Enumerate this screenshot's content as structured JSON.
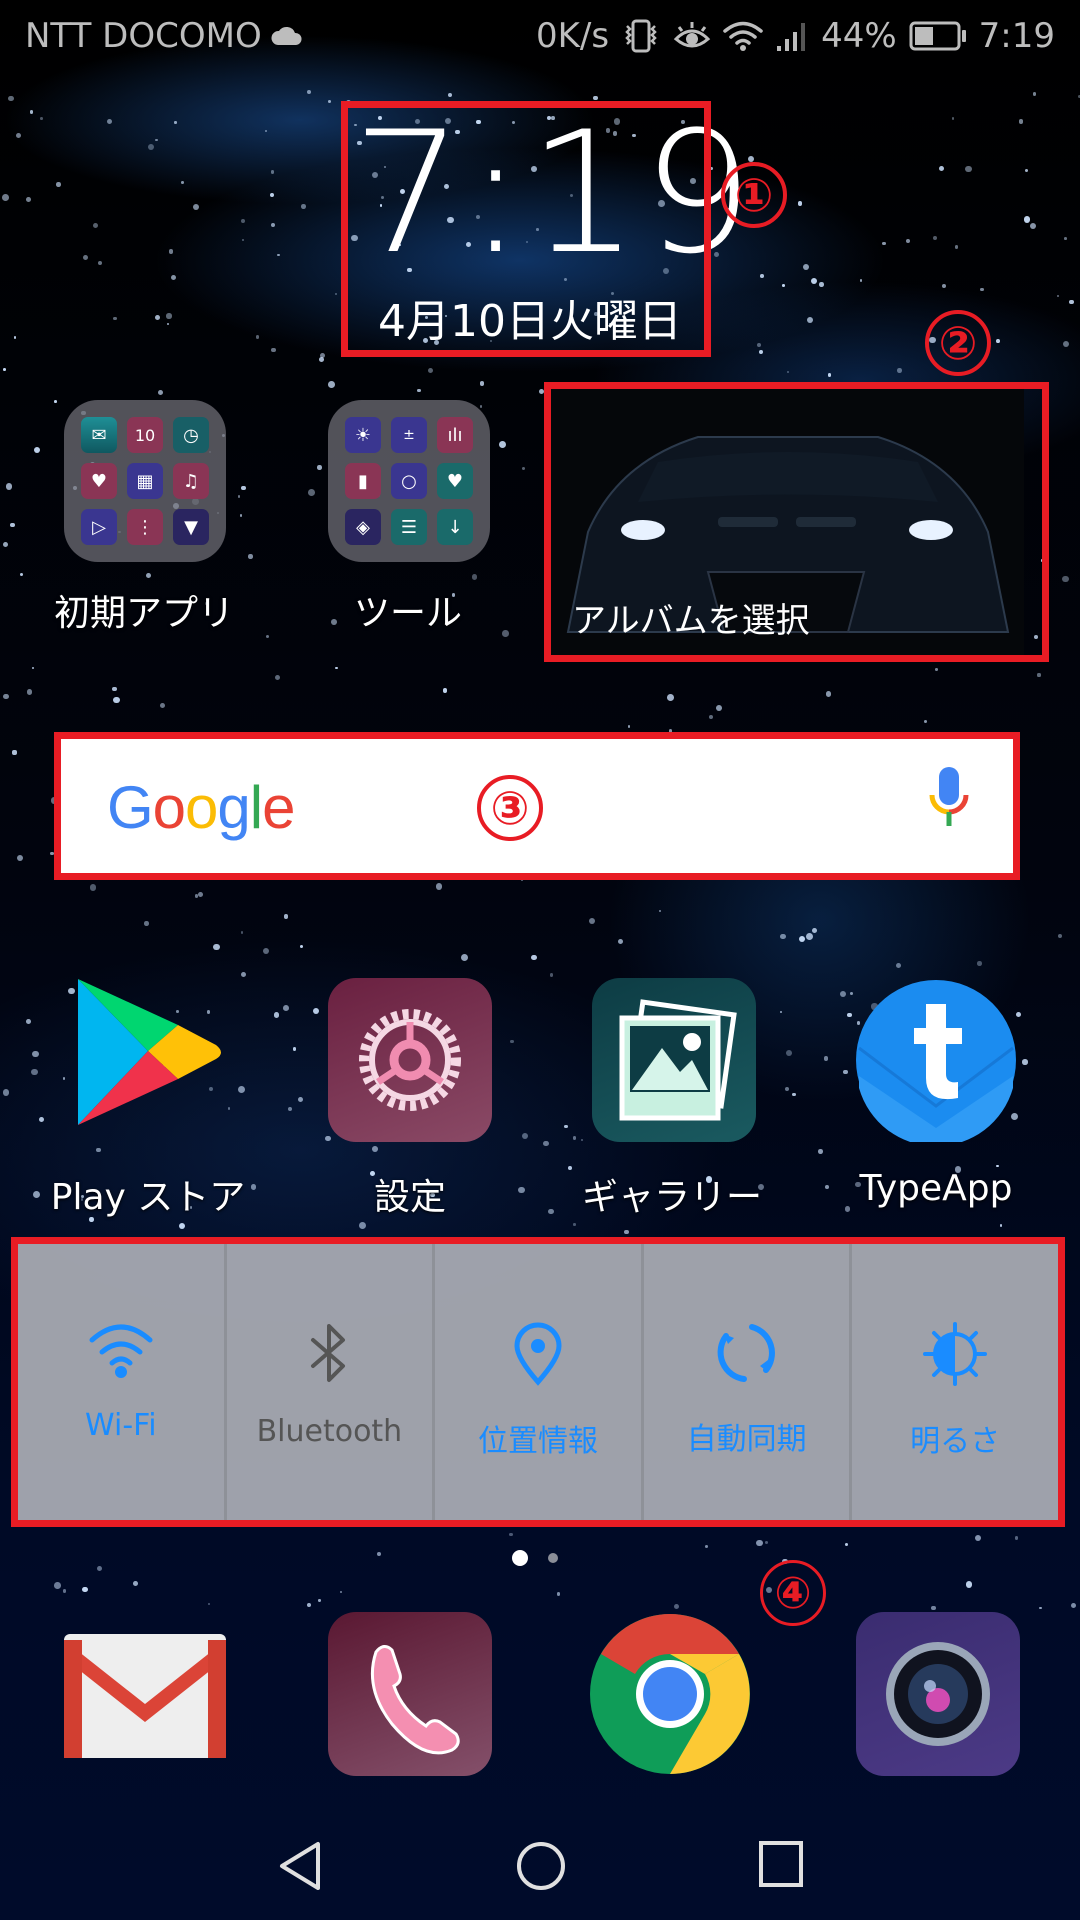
{
  "status_bar": {
    "carrier": "NTT DOCOMO",
    "carrier_icon": "cloud-icon",
    "net_speed": "0K/s",
    "icons": [
      "vibrate-icon",
      "eye-comfort-icon",
      "wifi-icon",
      "signal-icon"
    ],
    "battery_percent": "44%",
    "battery_level": 0.44,
    "time": "7:19"
  },
  "clock_widget": {
    "time": "7:19",
    "date": "4月10日火曜日"
  },
  "folders": [
    {
      "label": "初期アプリ",
      "icon": "folder-icon"
    },
    {
      "label": "ツール",
      "icon": "folder-icon"
    }
  ],
  "album_widget": {
    "label": "アルバムを選択"
  },
  "search_widget": {
    "logo": "Google",
    "mic_icon": "microphone-icon"
  },
  "apps": [
    {
      "label": "Play ストア",
      "icon": "play-store-icon"
    },
    {
      "label": "設定",
      "icon": "settings-icon"
    },
    {
      "label": "ギャラリー",
      "icon": "gallery-icon"
    },
    {
      "label": "TypeApp",
      "icon": "typeapp-icon"
    }
  ],
  "quick_settings": [
    {
      "label": "Wi-Fi",
      "icon": "wifi-icon",
      "active": true
    },
    {
      "label": "Bluetooth",
      "icon": "bluetooth-icon",
      "active": false
    },
    {
      "label": "位置情報",
      "icon": "location-icon",
      "active": true
    },
    {
      "label": "自動同期",
      "icon": "sync-icon",
      "active": true
    },
    {
      "label": "明るさ",
      "icon": "brightness-icon",
      "active": true
    }
  ],
  "page_indicator": {
    "pages": 2,
    "current": 1
  },
  "dock": [
    {
      "icon": "gmail-icon"
    },
    {
      "icon": "phone-icon"
    },
    {
      "icon": "chrome-icon"
    },
    {
      "icon": "camera-icon"
    }
  ],
  "annotations": [
    "①",
    "②",
    "③",
    "④"
  ],
  "colors": {
    "annotation_red": "#e81c24",
    "active_blue": "#1a8cff",
    "inactive_gray": "#555555"
  }
}
